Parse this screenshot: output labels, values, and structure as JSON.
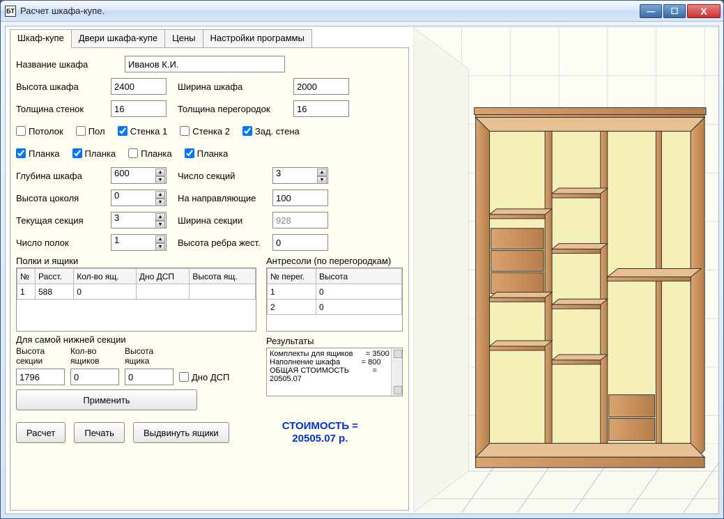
{
  "window": {
    "app_icon": "БТ",
    "title": "Расчет шкафа-купе."
  },
  "tabs": [
    "Шкаф-купе",
    "Двери шкафа-купе",
    "Цены",
    "Настройки программы"
  ],
  "labels": {
    "name": "Название шкафа",
    "height": "Высота шкафа",
    "width": "Ширина шкафа",
    "wall_th": "Толщина стенок",
    "part_th": "Толщина перегородок",
    "ceiling": "Потолок",
    "floor": "Пол",
    "wall1": "Стенка 1",
    "wall2": "Стенка 2",
    "back": "Зад. стена",
    "plank": "Планка",
    "depth": "Глубина шкафа",
    "sections": "Число секций",
    "base_h": "Высота цоколя",
    "rails": "На направляющие",
    "cur_sec": "Текущая секция",
    "sec_w": "Ширина секции",
    "shelves": "Число полок",
    "rib_h": "Высота ребра жест.",
    "shelves_drawers": "Полки и ящики",
    "mezzanines": "Антресоли (по перегородкам)",
    "lowest_section": "Для самой нижней секции",
    "low_h": "Высота\nсекции",
    "low_cnt": "Кол-во\nящиков",
    "low_drawer_h": "Высота\nящика",
    "dsp": "Дно ДСП",
    "apply": "Применить",
    "results": "Результаты",
    "calc": "Расчет",
    "print": "Печать",
    "extend": "Выдвинуть ящики",
    "price_label": "СТОИМОСТЬ ="
  },
  "values": {
    "name": "Иванов К.И.",
    "height": "2400",
    "width": "2000",
    "wall_th": "16",
    "part_th": "16",
    "depth": "600",
    "sections": "3",
    "base_h": "0",
    "rails": "100",
    "cur_sec": "3",
    "sec_w": "928",
    "shelves": "1",
    "rib_h": "0",
    "low_h": "1796",
    "low_cnt": "0",
    "low_drawer_h": "0"
  },
  "checks": {
    "ceiling": false,
    "floor": false,
    "wall1": true,
    "wall2": false,
    "back": true,
    "plank1": true,
    "plank2": true,
    "plank3": false,
    "plank4": true,
    "dsp": false
  },
  "shelves_table": {
    "headers": [
      "№",
      "Расст.",
      "Кол-во ящ.",
      "Дно ДСП",
      "Высота ящ."
    ],
    "rows": [
      [
        "1",
        "588",
        "0",
        "",
        ""
      ]
    ]
  },
  "mezz_table": {
    "headers": [
      "№ перег.",
      "Высота"
    ],
    "rows": [
      [
        "1",
        "0"
      ],
      [
        "2",
        "0"
      ]
    ]
  },
  "results_text": "Комплекты для ящиков      = 3500\nНаполнение шкафа          = 800\nОБЩАЯ СТОИМОСТЬ           =\n20505.07",
  "price_value": "20505.07 р."
}
